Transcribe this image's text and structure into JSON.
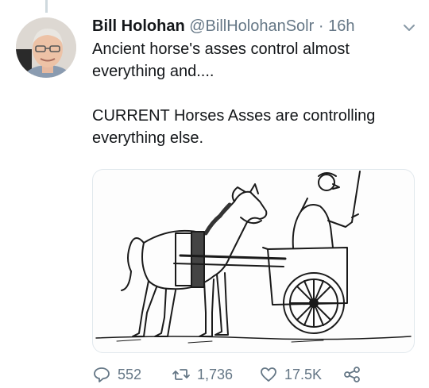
{
  "tweet": {
    "display_name": "Bill Holohan",
    "handle": "@BillHolohanSolr",
    "separator": "·",
    "timestamp": "16h",
    "text_paragraph_1": "Ancient horse's asses control almost everything and....",
    "text_paragraph_2": "CURRENT Horses Asses are controlling everything else."
  },
  "actions": {
    "reply_count": "552",
    "retweet_count": "1,736",
    "like_count": "17.5K"
  },
  "icons": {
    "caret": "chevron-down-icon",
    "reply": "reply-icon",
    "retweet": "retweet-icon",
    "like": "heart-icon",
    "share": "share-icon"
  },
  "colors": {
    "text": "#14171a",
    "muted": "#657786",
    "border": "#e1e8ed"
  }
}
